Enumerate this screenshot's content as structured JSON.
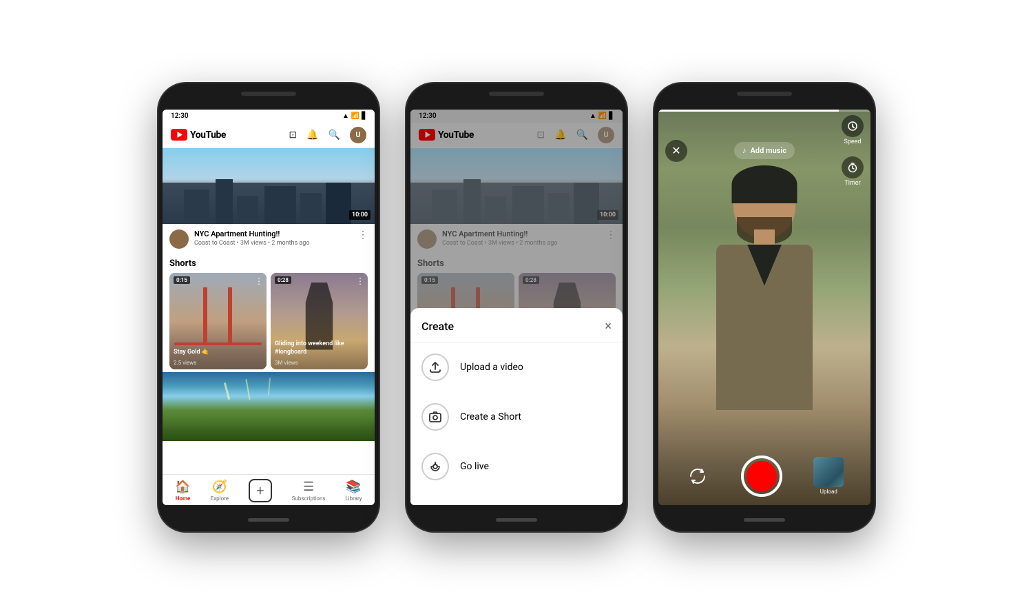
{
  "page": {
    "background": "#ffffff"
  },
  "phone1": {
    "status": {
      "time": "12:30",
      "icons": [
        "wifi",
        "signal",
        "battery"
      ]
    },
    "header": {
      "logo_text": "YouTube",
      "icons": [
        "cast",
        "bell",
        "search",
        "avatar"
      ]
    },
    "featured_video": {
      "duration": "10:00",
      "title": "NYC Apartment Hunting!!",
      "channel": "Coast to Coast",
      "meta": "3M views • 2 months ago"
    },
    "shorts_section": {
      "title": "Shorts",
      "items": [
        {
          "duration": "0:15",
          "label": "Stay Gold 🤙",
          "views": "2.5 views"
        },
        {
          "duration": "0:28",
          "label": "Gliding into weekend like #longboard",
          "views": "3M views"
        }
      ]
    },
    "nav": {
      "items": [
        "Home",
        "Explore",
        "",
        "Subscriptions",
        "Library"
      ],
      "active": "Home"
    }
  },
  "phone2": {
    "status": {
      "time": "12:30"
    },
    "header": {
      "logo_text": "YouTube"
    },
    "featured_video": {
      "duration": "10:00",
      "title": "NYC Apartment Hunting!!",
      "channel": "Coast to Coast",
      "meta": "3M views • 2 months ago"
    },
    "shorts_section": {
      "title": "Shorts"
    },
    "create_modal": {
      "title": "Create",
      "close_label": "×",
      "items": [
        {
          "icon": "upload",
          "label": "Upload a video"
        },
        {
          "icon": "camera",
          "label": "Create a Short"
        },
        {
          "icon": "live",
          "label": "Go live"
        }
      ]
    }
  },
  "phone3": {
    "top_bar": {
      "add_music_label": "Add music",
      "speed_label": "Speed",
      "timer_label": "Timer"
    },
    "bottom_bar": {
      "upload_label": "Upload"
    }
  }
}
